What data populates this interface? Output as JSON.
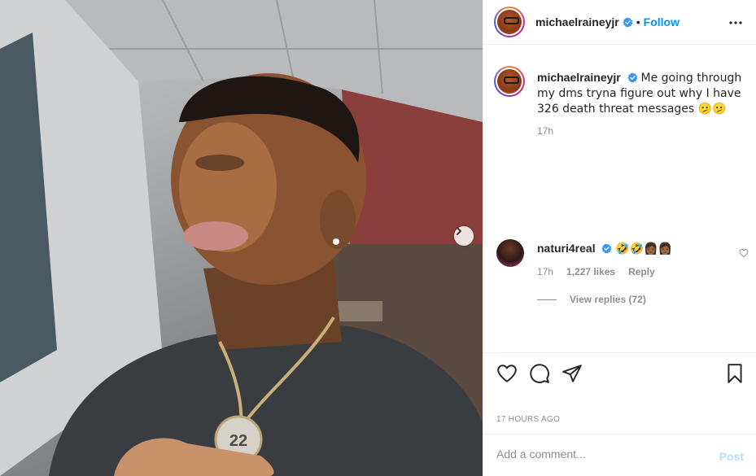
{
  "post": {
    "next_icon": "chevron-right-icon"
  },
  "header": {
    "username": "michaelraineyjr",
    "separator": "•",
    "follow_label": "Follow",
    "more_icon": "more-horizontal-icon"
  },
  "caption": {
    "username": "michaelraineyjr",
    "text": "Me going through my dms tryna figure out why I have 326 death threat messages 🫤🫤",
    "time": "17h"
  },
  "comment": {
    "username": "naturi4real",
    "text": "🤣🤣👩🏾👩🏾",
    "time": "17h",
    "likes": "1,227 likes",
    "reply_label": "Reply",
    "view_replies": "View replies (72)"
  },
  "actions": {
    "like_icon": "heart-icon",
    "comment_icon": "comment-icon",
    "share_icon": "send-icon",
    "save_icon": "bookmark-icon"
  },
  "timestamp": "17 HOURS AGO",
  "comment_box": {
    "placeholder": "Add a comment...",
    "post_label": "Post"
  },
  "colors": {
    "link_blue": "#0095f6",
    "post_disabled": "#b2dffc",
    "verified": "#3897f0",
    "muted": "#8e8e8e"
  }
}
